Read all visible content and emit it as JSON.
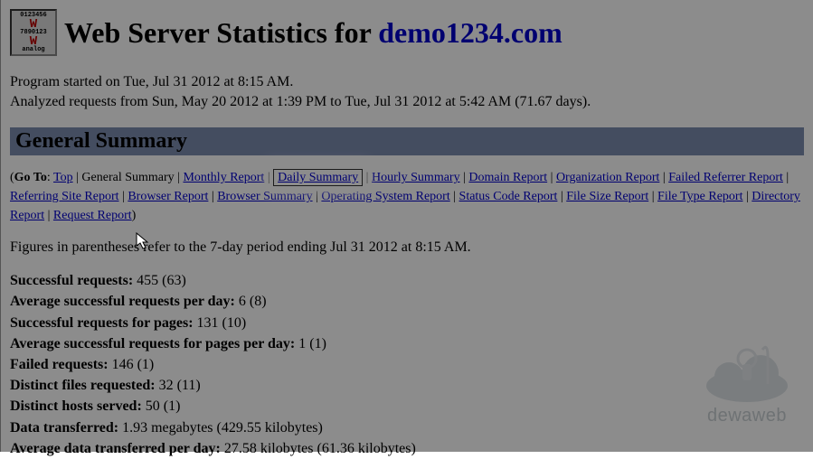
{
  "title_prefix": "Web Server Statistics for ",
  "domain": "demo1234.com",
  "meta_line1": "Program started on Tue, Jul 31 2012 at 8:15 AM.",
  "meta_line2": "Analyzed requests from Sun, May 20 2012 at 1:39 PM to Tue, Jul 31 2012 at 5:42 AM (71.67 days).",
  "section_heading": "General Summary",
  "nav": {
    "goto_label": "Go To",
    "top": "Top",
    "current": "General Summary",
    "links_before": [
      "Monthly Report"
    ],
    "highlighted": "Daily Summary",
    "links_after": [
      "Hourly Summary",
      "Domain Report",
      "Organization Report",
      "Failed Referrer Report",
      "Referring Site Report",
      "Browser Report",
      "Browser Summary",
      "Operating System Report",
      "Status Code Report",
      "File Size Report",
      "File Type Report",
      "Directory Report",
      "Request Report"
    ]
  },
  "figures_note": "Figures in parentheses refer to the 7-day period ending Jul 31 2012 at 8:15 AM.",
  "stats": [
    {
      "label": "Successful requests:",
      "value": "455 (63)"
    },
    {
      "label": "Average successful requests per day:",
      "value": "6 (8)"
    },
    {
      "label": "Successful requests for pages:",
      "value": "131 (10)"
    },
    {
      "label": "Average successful requests for pages per day:",
      "value": "1 (1)"
    },
    {
      "label": "Failed requests:",
      "value": "146 (1)"
    },
    {
      "label": "Distinct files requested:",
      "value": "32 (11)"
    },
    {
      "label": "Distinct hosts served:",
      "value": "50 (1)"
    },
    {
      "label": "Data transferred:",
      "value": "1.93 megabytes (429.55 kilobytes)"
    },
    {
      "label": "Average data transferred per day:",
      "value": "27.58 kilobytes (61.36 kilobytes)"
    }
  ],
  "watermark": "dewaweb"
}
